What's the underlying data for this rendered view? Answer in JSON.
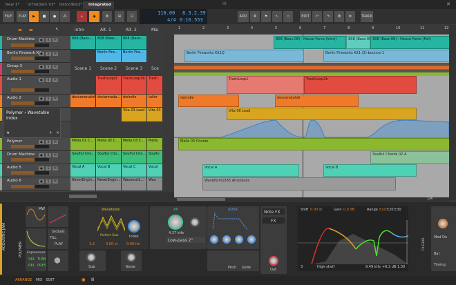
{
  "tabs": [
    "New 1*",
    "InTheDark V3*",
    "DemoTest2*",
    "Integrated"
  ],
  "toolbar": {
    "file": "FILE",
    "play": "PLAY",
    "add": "ADD",
    "edit": "EDIT",
    "track": "TRACK"
  },
  "transport": {
    "tempo": "110.00",
    "signature": "4/4",
    "position": "8.3.2.39",
    "time": "0:16.553"
  },
  "colors": {
    "accent": "#f08c1e",
    "teal": "#26b5a0",
    "blue": "#7ab8d8",
    "red": "#e24b3f",
    "orange": "#ef7a2a",
    "yellow": "#d9a520",
    "green": "#8ab82e",
    "vocal": "#4fd1b6"
  },
  "tracks": [
    {
      "name": "Drum Machine",
      "color": "#26b5a0"
    },
    {
      "name": "Berlin Firework Kit",
      "color": "#4fb8e8"
    },
    {
      "name": "Group 3",
      "color": "#d23c6a"
    },
    {
      "name": "Audio 1",
      "color": "#e24b3f"
    },
    {
      "name": "Audio 2",
      "color": "#ef7a2a"
    },
    {
      "name": "Acoustic Jam",
      "color": "#d9a520"
    },
    {
      "name": "Polymer",
      "color": "#8ab82e"
    },
    {
      "name": "Drum Machine",
      "color": "#3cc07a"
    },
    {
      "name": "Audio 5",
      "color": "#4fd1b6"
    },
    {
      "name": "Audio 6",
      "color": "#999999"
    }
  ],
  "device_chain_popup": {
    "title": "Polymer › Wavetable",
    "subtitle": "Index"
  },
  "scenes": [
    "intro",
    "Alt. 1",
    "Alt. 2",
    "Mai"
  ],
  "scene_names": [
    "Scene 1",
    "Scene 2",
    "Scene 3",
    "Sce"
  ],
  "launcher_clips": [
    {
      "row": 0,
      "col": 0,
      "label": "808 (Bass-...",
      "color": "#26b5a0"
    },
    {
      "row": 0,
      "col": 1,
      "label": "808 (Bass-...",
      "color": "#26b5a0"
    },
    {
      "row": 0,
      "col": 2,
      "label": "808 (Bass-...",
      "color": "#26b5a0"
    },
    {
      "row": 1,
      "col": 1,
      "label": "Berlin Fire...",
      "color": "#4fb8e8"
    },
    {
      "row": 1,
      "col": 2,
      "label": "Berlin Fire...",
      "color": "#4fb8e8"
    },
    {
      "row": 3,
      "col": 1,
      "label": "TrashLoop3",
      "color": "#e24b3f"
    },
    {
      "row": 3,
      "col": 2,
      "label": "TrashLoop2b",
      "color": "#e24b3f"
    },
    {
      "row": 3,
      "col": 3,
      "label": "Trash",
      "color": "#e24b3f"
    },
    {
      "row": 4,
      "col": 0,
      "label": "descenenatefall",
      "color": "#ef7a2a"
    },
    {
      "row": 4,
      "col": 1,
      "label": "dorianneda...",
      "color": "#ef7a2a"
    },
    {
      "row": 4,
      "col": 2,
      "label": "dwindle",
      "color": "#ef7a2a"
    },
    {
      "row": 4,
      "col": 3,
      "label": "tailor",
      "color": "#ef7a2a"
    },
    {
      "row": 5,
      "col": 2,
      "label": "Vita 03 Lead",
      "color": "#d9a520"
    },
    {
      "row": 5,
      "col": 3,
      "label": "Vita 03",
      "color": "#d9a520"
    },
    {
      "row": 6,
      "col": 0,
      "label": "Mella 01 C...",
      "color": "#8ab82e"
    },
    {
      "row": 6,
      "col": 1,
      "label": "Mella 02 C...",
      "color": "#8ab82e"
    },
    {
      "row": 6,
      "col": 2,
      "label": "Mella 03 C...",
      "color": "#8ab82e"
    },
    {
      "row": 6,
      "col": 3,
      "label": "Mella",
      "color": "#8ab82e"
    },
    {
      "row": 7,
      "col": 0,
      "label": "Soulful Cho...",
      "color": "#3cc07a"
    },
    {
      "row": 7,
      "col": 1,
      "label": "Soulful Cho...",
      "color": "#3cc07a"
    },
    {
      "row": 7,
      "col": 2,
      "label": "Soulful Cho...",
      "color": "#3cc07a"
    },
    {
      "row": 7,
      "col": 3,
      "label": "Soulfu",
      "color": "#3cc07a"
    },
    {
      "row": 8,
      "col": 0,
      "label": "Vocal A",
      "color": "#4fd1b6"
    },
    {
      "row": 8,
      "col": 1,
      "label": "Vocal B",
      "color": "#4fd1b6"
    },
    {
      "row": 8,
      "col": 2,
      "label": "Vocal C",
      "color": "#4fd1b6"
    },
    {
      "row": 8,
      "col": 3,
      "label": "Vocal",
      "color": "#4fd1b6"
    },
    {
      "row": 9,
      "col": 0,
      "label": "NeverEngin...",
      "color": "#8c8c8c"
    },
    {
      "row": 9,
      "col": 1,
      "label": "NeverEngin...",
      "color": "#8c8c8c"
    },
    {
      "row": 9,
      "col": 2,
      "label": "Waveout1...",
      "color": "#8c8c8c"
    },
    {
      "row": 9,
      "col": 3,
      "label": "Wav",
      "color": "#8c8c8c"
    }
  ],
  "ruler": [
    "1",
    "2",
    "3",
    "4",
    "5",
    "6",
    "7",
    "8",
    "9",
    "10",
    "11",
    "12"
  ],
  "arranger_clips": [
    {
      "row": 0,
      "start": 4.95,
      "end": 7.95,
      "label": "808 (Bass-08) - House Force (Intro)",
      "color": "#26b5a0"
    },
    {
      "row": 0,
      "start": 7.95,
      "end": 8.95,
      "label": "808 (Bass-08)",
      "color": "#5fcfbd"
    },
    {
      "row": 0,
      "start": 8.95,
      "end": 12.3,
      "label": "808 (Bass-08) - House Force (Fall)",
      "color": "#26b5a0"
    },
    {
      "row": 1,
      "start": 1.25,
      "end": 6.2,
      "label": "Berlin Fireworks Kit1Q",
      "color": "#7ab8d8"
    },
    {
      "row": 1,
      "start": 7.0,
      "end": 12.3,
      "label": "Berlin Fireworks Kit1 (2)-bounce-1",
      "color": "#7ab8d8"
    },
    {
      "row": 3,
      "start": 3.0,
      "end": 6.2,
      "label": "TrashLoop1",
      "color": "#e67a70"
    },
    {
      "row": 3,
      "start": 6.2,
      "end": 10.85,
      "label": "TrashLoop2b",
      "color": "#e24b3f"
    },
    {
      "row": 4,
      "start": 1.0,
      "end": 3.5,
      "label": "dwindle",
      "color": "#ef7a2a"
    },
    {
      "row": 4,
      "start": 5.0,
      "end": 8.45,
      "label": "descenatefall",
      "color": "#ef7a2a"
    },
    {
      "row": 5,
      "start": 3.0,
      "end": 10.85,
      "label": "Vita 06 Lead",
      "color": "#d9a520"
    },
    {
      "row": 6,
      "start": 1.0,
      "end": 12.3,
      "label": "Mella 03 Chords",
      "color": "#8ab82e"
    },
    {
      "row": 7,
      "start": 8.95,
      "end": 12.3,
      "label": "Soulful Chords 02 A",
      "color": "#8cc29a"
    },
    {
      "row": 8,
      "start": 2.0,
      "end": 6.0,
      "label": "Vocal A",
      "color": "#4fd1b6"
    },
    {
      "row": 8,
      "start": 7.0,
      "end": 10.85,
      "label": "Vocal B",
      "color": "#4fd1b6"
    },
    {
      "row": 9,
      "start": 2.0,
      "end": 10.0,
      "label": "Waveform1565 Airsolaces",
      "color": "#9a9a9a"
    }
  ],
  "device": {
    "track_label": "ACOUSTIC JAM",
    "chain_label": "POLYMER",
    "mw": "MW",
    "globals": "Globals",
    "globals_items": [
      "FILL",
      "PLAY"
    ],
    "expressions": "Expressions",
    "expr_items": [
      "VEL",
      "TIMB",
      "REL",
      "PRES"
    ],
    "wavetable": {
      "title": "Wavetable",
      "preset": "Perfect Saw",
      "index": "Index",
      "ratio": "1:2",
      "amount": "0.00 st",
      "freq": "0.00 Hz",
      "sub": "Sub",
      "noise": "Noise"
    },
    "filter": {
      "title": "XP",
      "freq": "4.37 kHz",
      "type": "Low-pass 2\""
    },
    "adsr": {
      "title": "ADSR",
      "labels": [
        "A",
        "D",
        "S",
        "R"
      ]
    },
    "env2_labels": [
      "A",
      "D",
      "S",
      "R"
    ],
    "pitch": "Pitch",
    "glide": "Glide",
    "out": "Out",
    "note_fx": "Note FX",
    "fx": "FX",
    "eq": {
      "shift_label": "Shift",
      "shift": "0.00 st",
      "gain_label": "Gain",
      "gain": "0.0 dB",
      "range_label": "Range",
      "ranges": [
        "±10",
        "±20",
        "±30"
      ],
      "band": "3",
      "shape": "High-shelf",
      "freq": "9.49 kHz",
      "band_gain": "+6.2 dB",
      "q": "1.00",
      "fx_label": "FX GRID"
    },
    "next": {
      "mod": "Mod Do",
      "bar": "Bar",
      "timing": "Timing"
    }
  },
  "status": {
    "arrange": "ARRANGE",
    "mix": "MIX",
    "edit": "EDIT",
    "zoom": "1/4"
  }
}
